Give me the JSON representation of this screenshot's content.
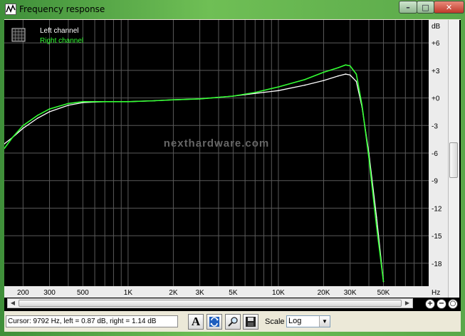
{
  "window": {
    "title": "Frequency response",
    "minimize_glyph": "–",
    "maximize_glyph": "□",
    "close_glyph": "✕",
    "icon": "frequency-response-icon"
  },
  "legend": {
    "left_label": "Left channel",
    "right_label": "Right channel",
    "left_color": "#ffffff",
    "right_color": "#33ff33",
    "icon": "grid-toggle-icon"
  },
  "watermark": "nexthardware.com",
  "chart_data": {
    "type": "line",
    "x_scale": "log",
    "xlim": [
      150,
      100000
    ],
    "ylim": [
      -20.5,
      8.5
    ],
    "grid": true,
    "y_unit_label": "dB",
    "x_unit_label": "Hz",
    "y_ticks": [
      "+6",
      "+3",
      "+0",
      "-3",
      "-6",
      "-9",
      "-12",
      "-15",
      "-18"
    ],
    "y_tick_values": [
      6,
      3,
      0,
      -3,
      -6,
      -9,
      -12,
      -15,
      -18
    ],
    "x_ticks": [
      "200",
      "300",
      "500",
      "1K",
      "2K",
      "3K",
      "5K",
      "10K",
      "20K",
      "30K",
      "50K"
    ],
    "x_tick_values": [
      200,
      300,
      500,
      1000,
      2000,
      3000,
      5000,
      10000,
      20000,
      30000,
      50000
    ],
    "series": [
      {
        "name": "Left channel",
        "color": "#ffffff",
        "x": [
          150,
          170,
          200,
          250,
          300,
          400,
          500,
          700,
          1000,
          1500,
          2000,
          3000,
          5000,
          7000,
          10000,
          15000,
          20000,
          25000,
          28000,
          30000,
          33000,
          36000,
          40000,
          45000,
          50000
        ],
        "y": [
          -5.0,
          -4.3,
          -3.3,
          -2.2,
          -1.5,
          -0.8,
          -0.5,
          -0.4,
          -0.4,
          -0.3,
          -0.2,
          -0.1,
          0.2,
          0.5,
          0.8,
          1.4,
          1.9,
          2.4,
          2.6,
          2.5,
          1.8,
          -1.0,
          -6.0,
          -13.0,
          -20.0
        ]
      },
      {
        "name": "Right channel",
        "color": "#33ff33",
        "x": [
          150,
          170,
          200,
          250,
          300,
          400,
          500,
          700,
          1000,
          1500,
          2000,
          3000,
          5000,
          7000,
          10000,
          15000,
          20000,
          25000,
          28000,
          30000,
          33000,
          36000,
          40000,
          45000,
          50000
        ],
        "y": [
          -5.5,
          -4.3,
          -3.0,
          -1.9,
          -1.2,
          -0.6,
          -0.4,
          -0.4,
          -0.4,
          -0.3,
          -0.2,
          -0.1,
          0.2,
          0.6,
          1.2,
          2.0,
          2.8,
          3.3,
          3.6,
          3.5,
          2.6,
          -0.8,
          -6.5,
          -14.0,
          -20.0
        ]
      }
    ]
  },
  "status": {
    "cursor_text": "Cursor:  9792 Hz,  left = 0.87 dB,  right = 1.14 dB",
    "scale_label": "Scale",
    "scale_value": "Log"
  },
  "toolbar": {
    "font_button_label": "A",
    "icons": [
      "font-icon",
      "refresh-icon",
      "zoom-tool-icon",
      "save-icon"
    ]
  },
  "zoom": {
    "zoom_in_glyph": "+",
    "zoom_out_glyph": "−",
    "zoom_reset_glyph": "○"
  }
}
